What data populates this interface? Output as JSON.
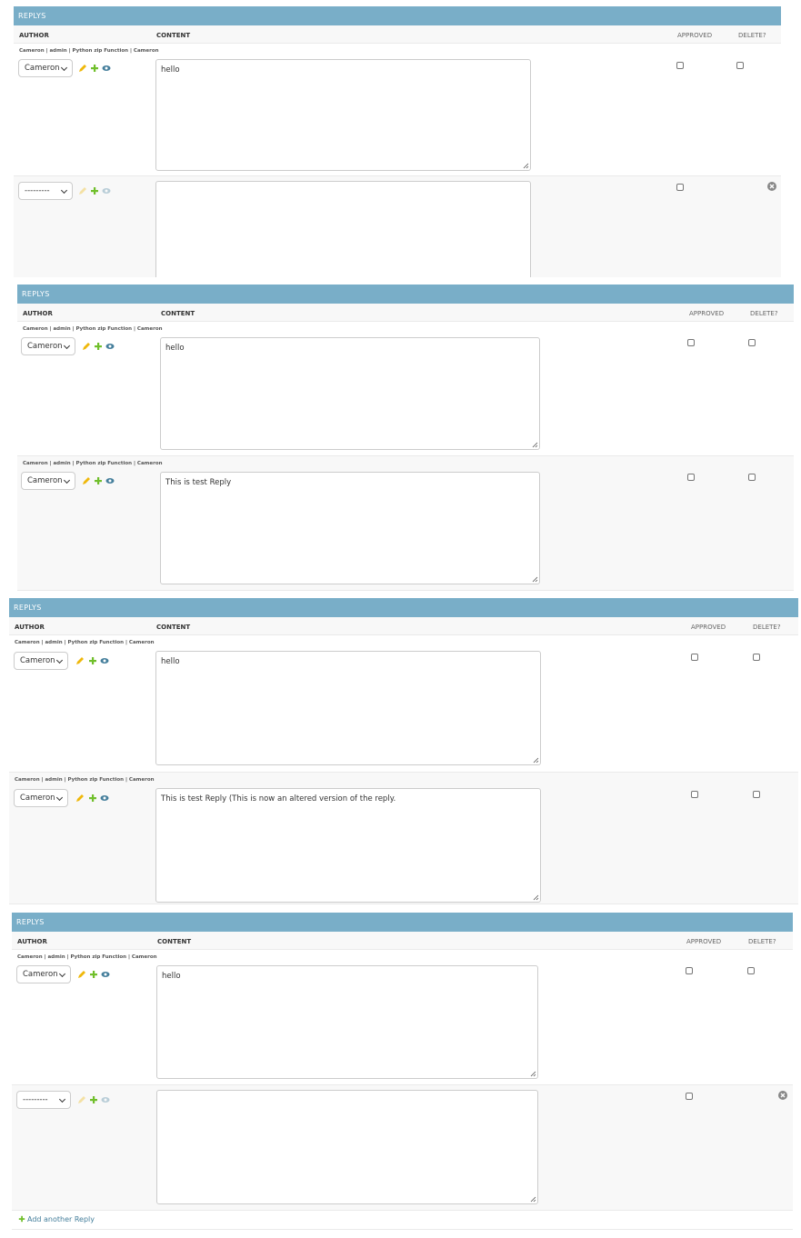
{
  "colors": {
    "caption_bg": "#79aec8",
    "link": "#447e9b",
    "change_icon": "#efb80b",
    "add_icon": "#70bf2b",
    "view_icon": "#447e9b"
  },
  "headers": {
    "caption": "REPLYS",
    "author": "AUTHOR",
    "content": "CONTENT",
    "approved": "APPROVED",
    "delete": "DELETE?"
  },
  "original_label": "Cameron | admin | Python zip Function | Cameron",
  "author_selected": "Cameron",
  "author_empty": "---------",
  "content_hello": "hello",
  "content_reply": "This is test Reply",
  "content_reply_altered": "This is test Reply (This is now an altered version of the reply.",
  "add_another": "Add another Reply",
  "icons": {
    "change": "pencil-icon",
    "add": "plus-icon",
    "view": "eye-icon",
    "remove": "remove-circle-icon",
    "dropdown": "chevron-down-icon"
  }
}
